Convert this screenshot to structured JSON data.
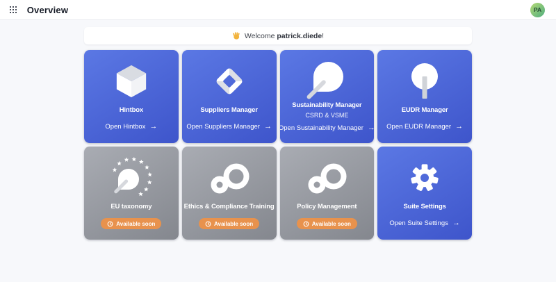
{
  "header": {
    "app_title": "Overview",
    "avatar_initials": "PA"
  },
  "banner": {
    "greeting": "Welcome",
    "username": "patrick.diede",
    "punctuation": "!"
  },
  "glyphs": {
    "arrow_right": "→"
  },
  "cards": [
    {
      "title": "Hintbox",
      "link_label": "Open Hintbox",
      "status": "active",
      "icon": "cube-icon"
    },
    {
      "title": "Suppliers Manager",
      "link_label": "Open Suppliers Manager",
      "status": "active",
      "icon": "diamond-icon"
    },
    {
      "title": "Sustainability Manager",
      "subtitle": "CSRD & VSME",
      "link_label": "Open Sustainability Manager",
      "status": "active",
      "icon": "leaf-icon"
    },
    {
      "title": "EUDR Manager",
      "link_label": "Open EUDR Manager",
      "status": "active",
      "icon": "tree-icon"
    },
    {
      "title": "EU taxonomy",
      "badge_label": "Available soon",
      "status": "coming-soon",
      "icon": "leaf-eu-stars-icon"
    },
    {
      "title": "Ethics & Compliance Training",
      "badge_label": "Available soon",
      "status": "coming-soon",
      "icon": "loop-icon"
    },
    {
      "title": "Policy Management",
      "badge_label": "Available soon",
      "status": "coming-soon",
      "icon": "loop-icon"
    },
    {
      "title": "Suite Settings",
      "link_label": "Open Suite Settings",
      "status": "active",
      "icon": "gear-icon"
    }
  ],
  "colors": {
    "card_blue_start": "#5b78e4",
    "card_blue_end": "#3e55cb",
    "card_gray_start": "#a9acb3",
    "card_gray_end": "#84878e",
    "badge_orange": "#e8924d",
    "avatar_green_start": "#b6d977",
    "avatar_green_end": "#4fae7d",
    "page_background": "#f7f8fb",
    "header_background": "#ffffff"
  }
}
